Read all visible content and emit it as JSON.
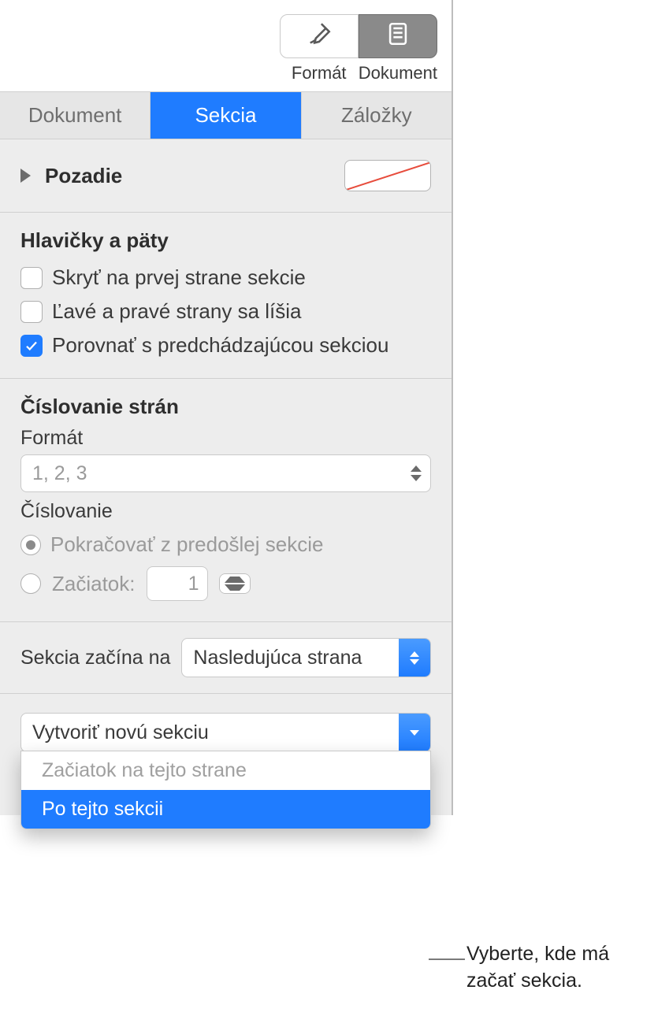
{
  "toolbar": {
    "format_label": "Formát",
    "document_label": "Dokument"
  },
  "tabs": {
    "document": "Dokument",
    "section": "Sekcia",
    "bookmarks": "Záložky"
  },
  "background": {
    "title": "Pozadie"
  },
  "headers": {
    "title": "Hlavičky a päty",
    "hide_first": "Skryť na prvej strane sekcie",
    "lr_differ": "Ľavé a pravé strany sa líšia",
    "match_prev": "Porovnať s predchádzajúcou sekciou"
  },
  "pagenum": {
    "title": "Číslovanie strán",
    "format_label": "Formát",
    "format_value": "1, 2, 3",
    "numbering_label": "Číslovanie",
    "continue_label": "Pokračovať z predošlej sekcie",
    "start_label": "Začiatok:",
    "start_value": "1"
  },
  "section_starts": {
    "label": "Sekcia začína na",
    "value": "Nasledujúca strana"
  },
  "new_section": {
    "button_label": "Vytvoriť novú sekciu",
    "option_start_this_page": "Začiatok na tejto strane",
    "option_after_this_section": "Po tejto sekcii"
  },
  "callout": {
    "line1": "Vyberte, kde má",
    "line2": "začať sekcia."
  }
}
